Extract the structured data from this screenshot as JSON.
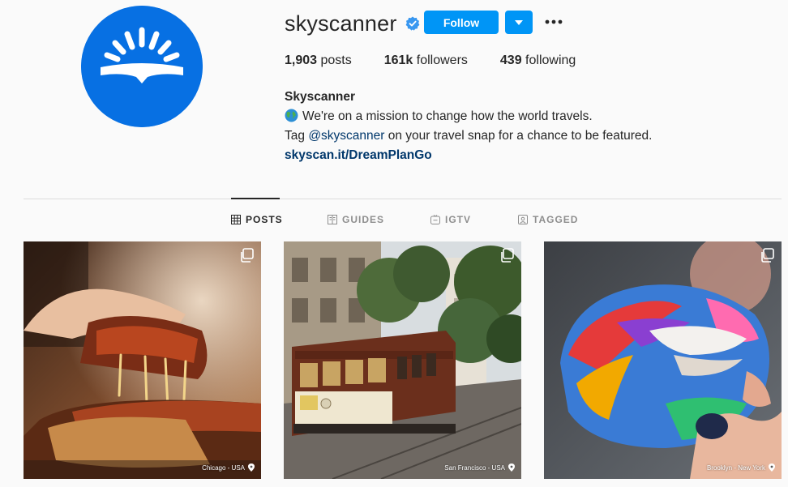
{
  "profile": {
    "username": "skyscanner",
    "follow_label": "Follow",
    "stats": {
      "posts_count": "1,903",
      "posts_label": " posts",
      "followers_count": "161k",
      "followers_label": " followers",
      "following_count": "439",
      "following_label": " following"
    },
    "bio": {
      "name": "Skyscanner",
      "line1": "We're on a mission to change how the world travels.",
      "line2_before": "Tag ",
      "line2_mention": "@skyscanner",
      "line2_after": " on your travel snap for a chance to be featured.",
      "link": "skyscan.it/DreamPlanGo"
    }
  },
  "tabs": [
    {
      "label": "POSTS",
      "icon": "grid-icon"
    },
    {
      "label": "GUIDES",
      "icon": "guide-icon"
    },
    {
      "label": "IGTV",
      "icon": "igtv-icon"
    },
    {
      "label": "TAGGED",
      "icon": "tagged-icon"
    }
  ],
  "posts": [
    {
      "location": "Chicago - USA",
      "subject": "deep dish pizza"
    },
    {
      "location": "San Francisco - USA",
      "subject": "cable car"
    },
    {
      "location": "Brooklyn - New York",
      "subject": "rainbow bagel"
    }
  ],
  "colors": {
    "brand": "#0770e3",
    "follow": "#0095f6",
    "link": "#00376b"
  }
}
